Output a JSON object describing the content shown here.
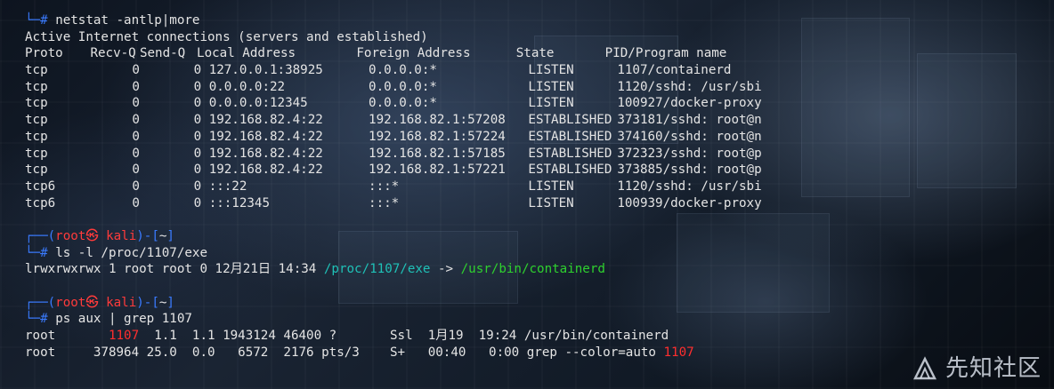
{
  "session1": {
    "prompt_corner": "└─",
    "prompt_hash": "#",
    "command": "netstat -antlp|more",
    "header_line": "Active Internet connections (servers and established)",
    "columns": {
      "proto": "Proto",
      "recvq": "Recv-Q",
      "sendq": "Send-Q",
      "local": "Local Address",
      "foreign": "Foreign Address",
      "state": "State",
      "pid": "PID/Program name"
    },
    "rows": [
      {
        "proto": "tcp",
        "recvq": "0",
        "sendq": "0",
        "local": "127.0.0.1:38925",
        "foreign": "0.0.0.0:*",
        "state": "LISTEN",
        "pid": "1107/containerd"
      },
      {
        "proto": "tcp",
        "recvq": "0",
        "sendq": "0",
        "local": "0.0.0.0:22",
        "foreign": "0.0.0.0:*",
        "state": "LISTEN",
        "pid": "1120/sshd: /usr/sbi"
      },
      {
        "proto": "tcp",
        "recvq": "0",
        "sendq": "0",
        "local": "0.0.0.0:12345",
        "foreign": "0.0.0.0:*",
        "state": "LISTEN",
        "pid": "100927/docker-proxy"
      },
      {
        "proto": "tcp",
        "recvq": "0",
        "sendq": "0",
        "local": "192.168.82.4:22",
        "foreign": "192.168.82.1:57208",
        "state": "ESTABLISHED",
        "pid": "373181/sshd: root@n"
      },
      {
        "proto": "tcp",
        "recvq": "0",
        "sendq": "0",
        "local": "192.168.82.4:22",
        "foreign": "192.168.82.1:57224",
        "state": "ESTABLISHED",
        "pid": "374160/sshd: root@n"
      },
      {
        "proto": "tcp",
        "recvq": "0",
        "sendq": "0",
        "local": "192.168.82.4:22",
        "foreign": "192.168.82.1:57185",
        "state": "ESTABLISHED",
        "pid": "372323/sshd: root@p"
      },
      {
        "proto": "tcp",
        "recvq": "0",
        "sendq": "0",
        "local": "192.168.82.4:22",
        "foreign": "192.168.82.1:57221",
        "state": "ESTABLISHED",
        "pid": "373885/sshd: root@p"
      },
      {
        "proto": "tcp6",
        "recvq": "0",
        "sendq": "0",
        "local": ":::22",
        "foreign": ":::*",
        "state": "LISTEN",
        "pid": "1120/sshd: /usr/sbi"
      },
      {
        "proto": "tcp6",
        "recvq": "0",
        "sendq": "0",
        "local": ":::12345",
        "foreign": ":::*",
        "state": "LISTEN",
        "pid": "100939/docker-proxy"
      }
    ]
  },
  "session2": {
    "prompt_top": "┌──(",
    "user_host": "root㉿ kali",
    "prompt_mid": ")-[",
    "cwd": "~",
    "prompt_end": "]",
    "prompt_corner": "└─",
    "prompt_hash": "#",
    "command": "ls -l /proc/1107/exe",
    "output_prefix": "lrwxrwxrwx 1 root root 0 12月21日 14:34 ",
    "link_path": "/proc/1107/exe",
    "arrow": " -> ",
    "target_path": "/usr/bin/containerd"
  },
  "session3": {
    "prompt_top": "┌──(",
    "user_host": "root㉿ kali",
    "prompt_mid": ")-[",
    "cwd": "~",
    "prompt_end": "]",
    "prompt_corner": "└─",
    "prompt_hash": "#",
    "command": "ps aux | grep 1107",
    "rows": [
      {
        "pre": "root       ",
        "pid": "1107",
        "post": "  1.1  1.1 1943124 46400 ?       Ssl  1月19  19:24 /usr/bin/containerd",
        "tail": ""
      },
      {
        "pre": "root     ",
        "pid": "378964",
        "post": " 25.0  0.0   6572  2176 pts/3    S+   00:40   0:00 grep --color=auto ",
        "tail": "1107"
      }
    ]
  },
  "watermark": {
    "text": "先知社区",
    "icon": "xianzhi-logo-icon"
  },
  "colors": {
    "prompt_blue": "#3a7bff",
    "user_red": "#ff3b3b",
    "exec_green": "#2ed12e",
    "link_teal": "#1fc1b7",
    "match_red": "#ff2e2e"
  }
}
